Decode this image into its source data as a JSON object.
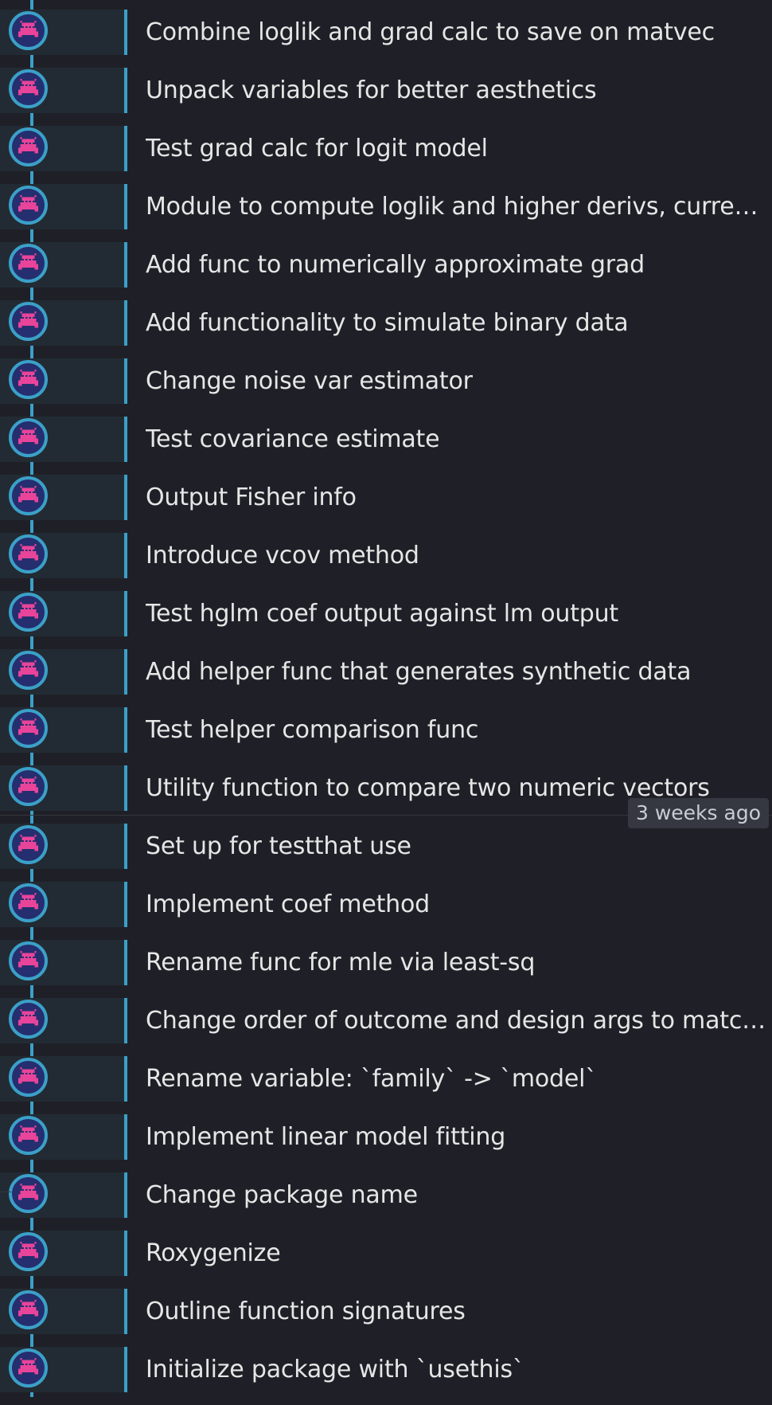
{
  "commit_history": {
    "avatar_icon": "pixel-invader-icon",
    "colors": {
      "background": "#1f2027",
      "graph_line": "#3ba0c8",
      "avatar_bg": "#252e6e",
      "avatar_glyph": "#e8449a",
      "message_text": "#e6e6e6"
    },
    "date_marker": "3 weeks ago",
    "commits": [
      {
        "message": "Combine loglik and grad calc to save on matvec"
      },
      {
        "message": "Unpack variables for better aesthetics"
      },
      {
        "message": "Test grad calc for logit model"
      },
      {
        "message": "Module to compute loglik and higher derivs, current…"
      },
      {
        "message": "Add func to numerically approximate grad"
      },
      {
        "message": "Add functionality to simulate binary data"
      },
      {
        "message": "Change noise var estimator"
      },
      {
        "message": "Test covariance estimate"
      },
      {
        "message": "Output Fisher info"
      },
      {
        "message": "Introduce vcov method"
      },
      {
        "message": "Test hglm coef output against lm output"
      },
      {
        "message": "Add helper func that generates synthetic data"
      },
      {
        "message": "Test helper comparison func"
      },
      {
        "message": "Utility function to compare two numeric vectors"
      },
      {
        "message": "Set up for testthat use"
      },
      {
        "message": "Implement coef method"
      },
      {
        "message": "Rename func for mle via least-sq"
      },
      {
        "message": "Change order of outcome and design args to match …"
      },
      {
        "message": "Rename variable: `family` -> `model`"
      },
      {
        "message": "Implement linear model fitting"
      },
      {
        "message": "Change package name"
      },
      {
        "message": "Roxygenize"
      },
      {
        "message": "Outline function signatures"
      },
      {
        "message": "Initialize package with `usethis`"
      }
    ]
  }
}
